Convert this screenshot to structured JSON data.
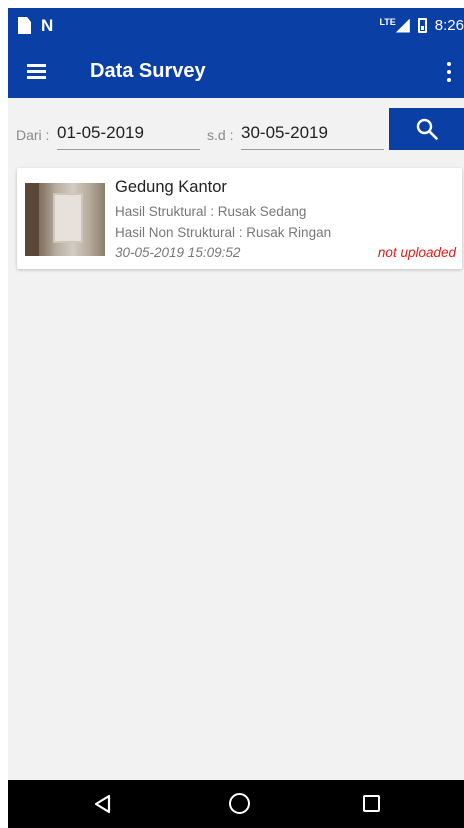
{
  "status_bar": {
    "time": "8:26",
    "network_label": "LTE",
    "icons": [
      "sim-card-icon",
      "n-notification-icon",
      "signal-icon",
      "battery-icon"
    ]
  },
  "app_bar": {
    "title": "Data Survey",
    "icons": [
      "menu-icon",
      "overflow-menu-icon"
    ],
    "color": "#0a3fa6"
  },
  "filter": {
    "from_label": "Dari :",
    "from_value": "01-05-2019",
    "to_label": "s.d :",
    "to_value": "30-05-2019",
    "search_icon": "search-icon"
  },
  "surveys": [
    {
      "title": "Gedung Kantor",
      "structural": "Hasil Struktural : Rusak Sedang",
      "non_structural": "Hasil Non Struktural : Rusak Ringan",
      "datetime": "30-05-2019 15:09:52",
      "status": "not uploaded",
      "status_color": "#e21b1b"
    }
  ],
  "nav_bar": {
    "icons": [
      "back-icon",
      "home-icon",
      "recents-icon"
    ]
  }
}
